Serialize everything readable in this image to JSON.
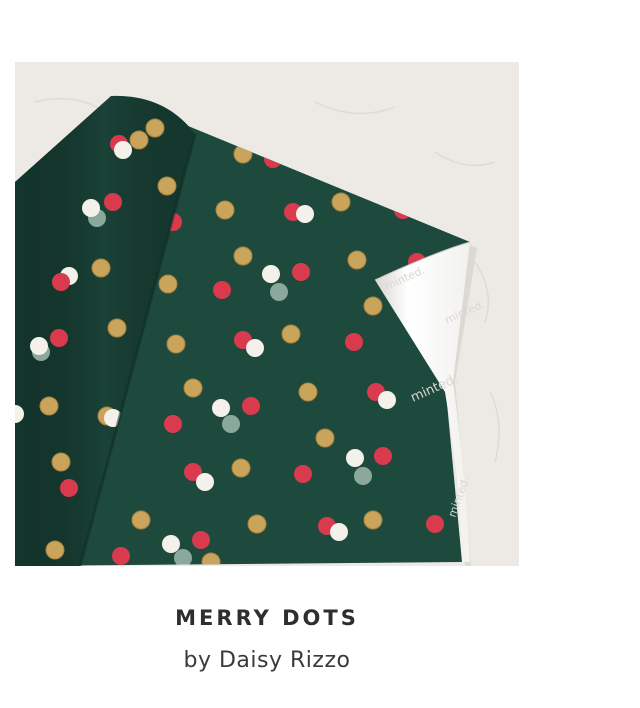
{
  "product": {
    "title": "MERRY DOTS",
    "artist": "by Daisy Rizzo",
    "image": {
      "brand_mark": "minted.",
      "colors": {
        "background": "#edeae6",
        "paper": "#1e4a3e",
        "paper_dark": "#143a30",
        "back_side": "#ffffff",
        "dot_red": "#d93a4e",
        "dot_gold": "#c9a45a",
        "dot_white": "#f4f1ea",
        "dot_sage": "#8aa99c"
      }
    }
  }
}
